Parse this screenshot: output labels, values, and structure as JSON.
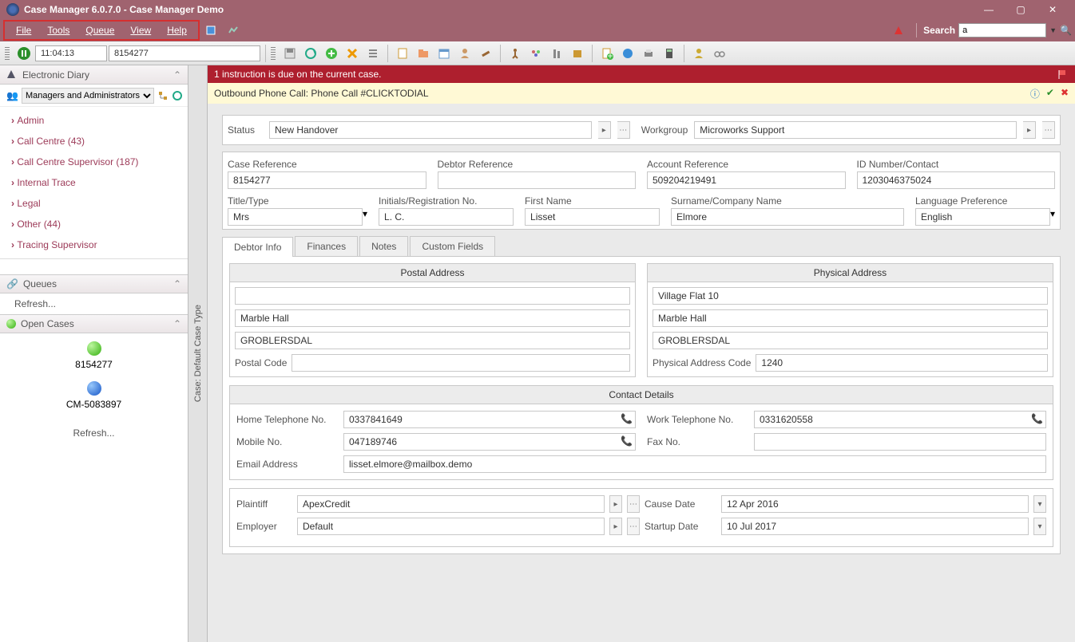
{
  "titlebar": {
    "title": "Case Manager 6.0.7.0 - Case Manager Demo"
  },
  "menu": {
    "file": "File",
    "tools": "Tools",
    "queue": "Queue",
    "view": "View",
    "help": "Help"
  },
  "search": {
    "label": "Search",
    "value": "a"
  },
  "toolbar": {
    "time": "11:04:13",
    "case_no": "8154277"
  },
  "sidebar": {
    "diary_title": "Electronic Diary",
    "group_selector": "Managers and Administrators",
    "tree": [
      {
        "label": "Admin"
      },
      {
        "label": "Call Centre (43)"
      },
      {
        "label": "Call Centre Supervisor (187)"
      },
      {
        "label": "Internal Trace"
      },
      {
        "label": "Legal"
      },
      {
        "label": "Other (44)"
      },
      {
        "label": "Tracing Supervisor"
      }
    ],
    "queues_title": "Queues",
    "queues_refresh": "Refresh...",
    "open_cases_title": "Open Cases",
    "open_cases": [
      {
        "label": "8154277",
        "orb": "green"
      },
      {
        "label": "CM-5083897",
        "orb": "blue"
      }
    ],
    "cases_refresh": "Refresh..."
  },
  "vert_tab": "Case: Default Case Type",
  "alertbar": {
    "text": "1 instruction is due on the current case."
  },
  "infobar": {
    "text": "Outbound Phone Call: Phone Call #CLICKTODIAL"
  },
  "status_row": {
    "status_label": "Status",
    "status_value": "New Handover",
    "workgroup_label": "Workgroup",
    "workgroup_value": "Microworks Support"
  },
  "refs": {
    "case_ref_label": "Case Reference",
    "case_ref_value": "8154277",
    "debtor_ref_label": "Debtor Reference",
    "debtor_ref_value": "",
    "account_ref_label": "Account Reference",
    "account_ref_value": "509204219491",
    "id_label": "ID Number/Contact",
    "id_value": "1203046375024"
  },
  "person": {
    "title_label": "Title/Type",
    "title_value": "Mrs",
    "initials_label": "Initials/Registration No.",
    "initials_value": "L. C.",
    "first_label": "First Name",
    "first_value": "Lisset",
    "surname_label": "Surname/Company Name",
    "surname_value": "Elmore",
    "lang_label": "Language Preference",
    "lang_value": "English"
  },
  "tabs": {
    "t1": "Debtor Info",
    "t2": "Finances",
    "t3": "Notes",
    "t4": "Custom Fields"
  },
  "postal": {
    "hdr": "Postal Address",
    "line1": "",
    "line2": "Marble Hall",
    "line3": "GROBLERSDAL",
    "code_label": "Postal Code",
    "code_value": ""
  },
  "physical": {
    "hdr": "Physical Address",
    "line1": "Village Flat 10",
    "line2": "Marble Hall",
    "line3": "GROBLERSDAL",
    "code_label": "Physical Address Code",
    "code_value": "1240"
  },
  "contact": {
    "hdr": "Contact Details",
    "home_label": "Home Telephone No.",
    "home_value": "0337841649",
    "work_label": "Work Telephone No.",
    "work_value": "0331620558",
    "mobile_label": "Mobile No.",
    "mobile_value": "047189746",
    "fax_label": "Fax No.",
    "fax_value": "",
    "email_label": "Email Address",
    "email_value": "lisset.elmore@mailbox.demo"
  },
  "bottom": {
    "plaintiff_label": "Plaintiff",
    "plaintiff_value": "ApexCredit",
    "cause_label": "Cause Date",
    "cause_value": "12 Apr 2016",
    "employer_label": "Employer",
    "employer_value": "Default",
    "startup_label": "Startup Date",
    "startup_value": "10 Jul 2017"
  }
}
